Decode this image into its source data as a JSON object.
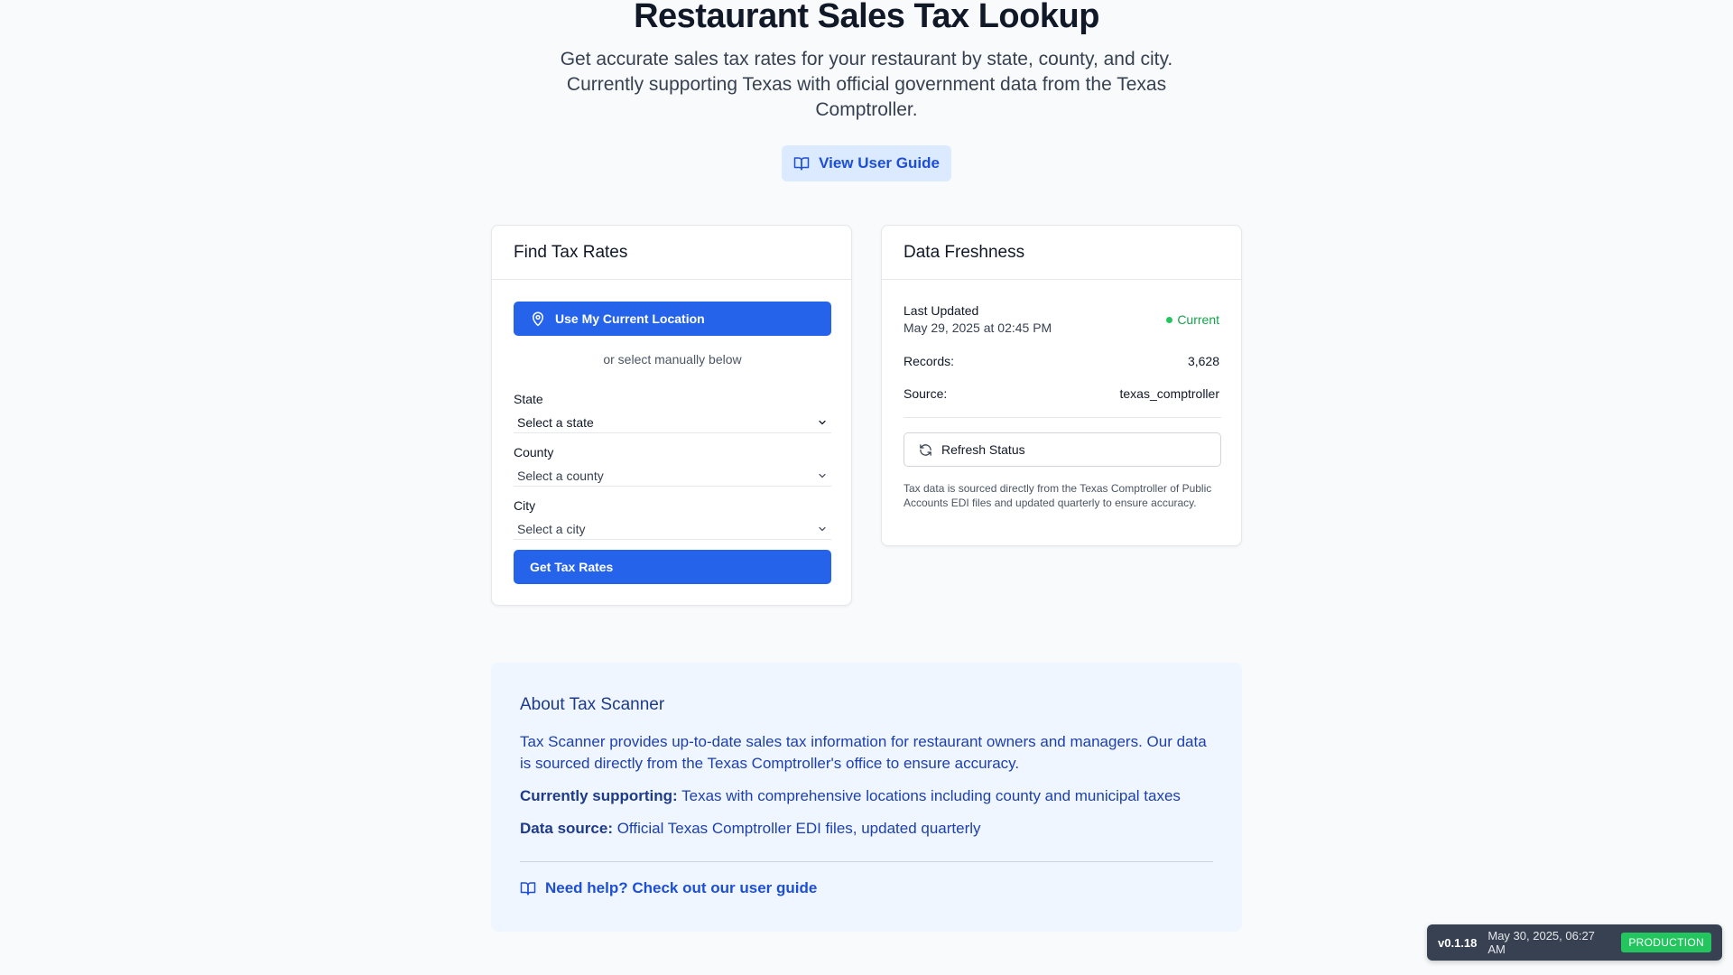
{
  "hero": {
    "title": "Restaurant Sales Tax Lookup",
    "subtitle": "Get accurate sales tax rates for your restaurant by state, county, and city. Currently supporting Texas with official government data from the Texas Comptroller.",
    "guide_button": "View User Guide"
  },
  "find": {
    "title": "Find Tax Rates",
    "location_button": "Use My Current Location",
    "or_text": "or select manually below",
    "state_label": "State",
    "state_value": "Select a state",
    "county_label": "County",
    "county_value": "Select a county",
    "city_label": "City",
    "city_value": "Select a city",
    "submit_button": "Get Tax Rates"
  },
  "freshness": {
    "title": "Data Freshness",
    "last_updated_label": "Last Updated",
    "last_updated_value": "May 29, 2025 at 02:45 PM",
    "status": "Current",
    "records_label": "Records:",
    "records_value": "3,628",
    "source_label": "Source:",
    "source_value": "texas_comptroller",
    "refresh_button": "Refresh Status",
    "note": "Tax data is sourced directly from the Texas Comptroller of Public Accounts EDI files and updated quarterly to ensure accuracy."
  },
  "about": {
    "title": "About Tax Scanner",
    "intro": "Tax Scanner provides up-to-date sales tax information for restaurant owners and managers. Our data is sourced directly from the Texas Comptroller's office to ensure accuracy.",
    "support_label": "Currently supporting:",
    "support_text": " Texas with comprehensive locations including county and municipal taxes",
    "source_label": "Data source:",
    "source_text": " Official Texas Comptroller EDI files, updated quarterly",
    "help_link": "Need help? Check out our user guide"
  },
  "version": {
    "number": "v0.1.18",
    "date": "May 30, 2025, 06:27 AM",
    "environment": "PRODUCTION"
  },
  "colors": {
    "primary": "#2563eb",
    "status_green": "#22c55e",
    "about_bg": "#eff6ff"
  },
  "icons": {
    "guide": "book-open-icon",
    "location": "map-pin-icon",
    "chevron": "chevron-down-icon",
    "refresh": "refresh-icon"
  }
}
